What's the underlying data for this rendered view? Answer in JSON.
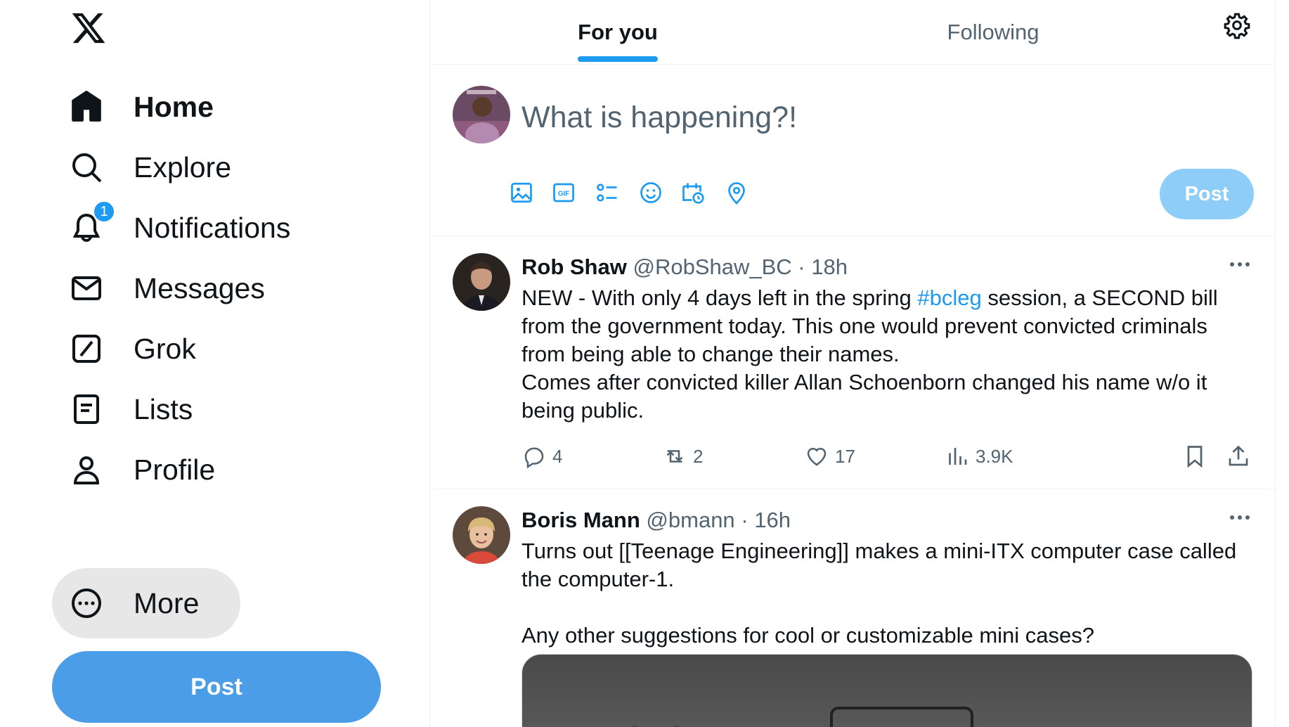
{
  "sidebar": {
    "logo": "x-logo",
    "items": [
      {
        "label": "Home",
        "icon": "home-icon"
      },
      {
        "label": "Explore",
        "icon": "search-icon"
      },
      {
        "label": "Notifications",
        "icon": "bell-icon",
        "badge": "1"
      },
      {
        "label": "Messages",
        "icon": "mail-icon"
      },
      {
        "label": "Grok",
        "icon": "grok-icon"
      },
      {
        "label": "Lists",
        "icon": "list-icon"
      },
      {
        "label": "Profile",
        "icon": "person-icon"
      },
      {
        "label": "More",
        "icon": "more-circle-icon"
      }
    ],
    "post_label": "Post"
  },
  "tabs": [
    {
      "label": "For you"
    },
    {
      "label": "Following"
    }
  ],
  "composer": {
    "placeholder": "What is happening?!",
    "tools": [
      "image-icon",
      "gif-icon",
      "poll-icon",
      "emoji-icon",
      "schedule-icon",
      "location-icon"
    ],
    "post_label": "Post"
  },
  "tweets": [
    {
      "name": "Rob Shaw",
      "handle": "@RobShaw_BC",
      "time": "· 18h",
      "text_before_tag": "NEW - With only 4 days left in the spring ",
      "hashtag": "#bcleg",
      "text_after_tag": " session, a SECOND bill from the government today. This one would prevent convicted criminals from being able to change their names.",
      "text_line2": "Comes after convicted killer Allan Schoenborn changed his name w/o it being public.",
      "replies": "4",
      "reposts": "2",
      "likes": "17",
      "views": "3.9K"
    },
    {
      "name": "Boris Mann",
      "handle": "@bmann",
      "time": "· 16h",
      "text_para1": "Turns out [[Teenage Engineering]] makes a mini-ITX computer case called the computer-1.",
      "text_para2": "Any other suggestions for cool or customizable mini cases?"
    }
  ],
  "colors": {
    "accent": "#1d9bf0",
    "post_button": "#4c9de8",
    "post_button_disabled": "#8ecdf7",
    "secondary_text": "#536471"
  }
}
